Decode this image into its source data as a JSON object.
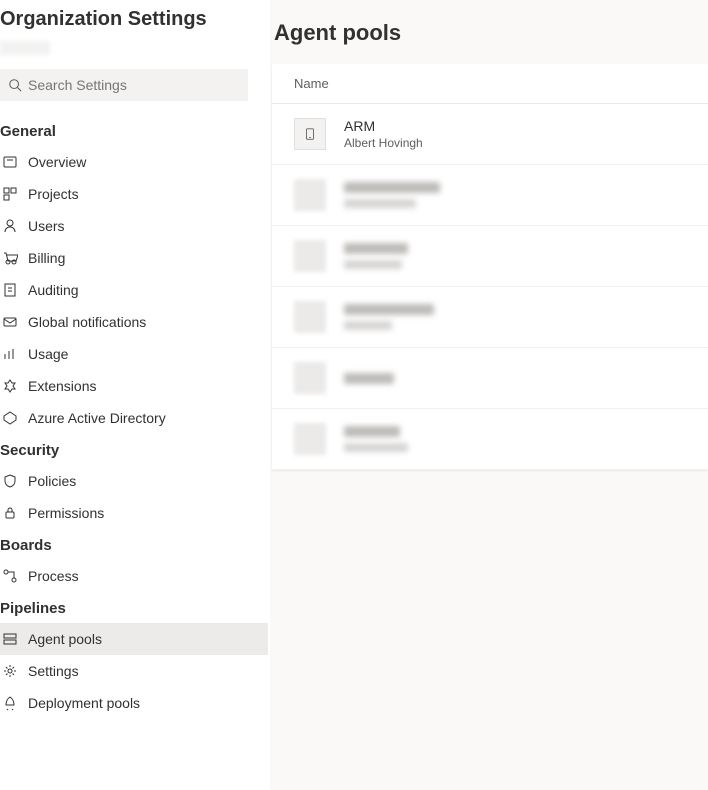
{
  "sidebar": {
    "title": "Organization Settings",
    "search_placeholder": "Search Settings",
    "groups": [
      {
        "label": "General",
        "items": [
          {
            "label": "Overview",
            "icon": "info-icon"
          },
          {
            "label": "Projects",
            "icon": "projects-icon"
          },
          {
            "label": "Users",
            "icon": "users-icon"
          },
          {
            "label": "Billing",
            "icon": "billing-icon"
          },
          {
            "label": "Auditing",
            "icon": "auditing-icon"
          },
          {
            "label": "Global notifications",
            "icon": "notifications-icon"
          },
          {
            "label": "Usage",
            "icon": "usage-icon"
          },
          {
            "label": "Extensions",
            "icon": "extensions-icon"
          },
          {
            "label": "Azure Active Directory",
            "icon": "aad-icon"
          }
        ]
      },
      {
        "label": "Security",
        "items": [
          {
            "label": "Policies",
            "icon": "policies-icon"
          },
          {
            "label": "Permissions",
            "icon": "permissions-icon"
          }
        ]
      },
      {
        "label": "Boards",
        "items": [
          {
            "label": "Process",
            "icon": "process-icon"
          }
        ]
      },
      {
        "label": "Pipelines",
        "items": [
          {
            "label": "Agent pools",
            "icon": "agent-pools-icon",
            "selected": true
          },
          {
            "label": "Settings",
            "icon": "settings-icon"
          },
          {
            "label": "Deployment pools",
            "icon": "deployment-icon"
          }
        ]
      }
    ]
  },
  "main": {
    "title": "Agent pools",
    "column_header": "Name",
    "pools": [
      {
        "name": "ARM",
        "owner": "Albert Hovingh"
      }
    ],
    "blurred_rows": [
      {
        "w1": 96,
        "w2": 72
      },
      {
        "w1": 64,
        "w2": 58
      },
      {
        "w1": 90,
        "w2": 48
      },
      {
        "w1": 50,
        "w2": 0
      },
      {
        "w1": 56,
        "w2": 64
      }
    ]
  }
}
